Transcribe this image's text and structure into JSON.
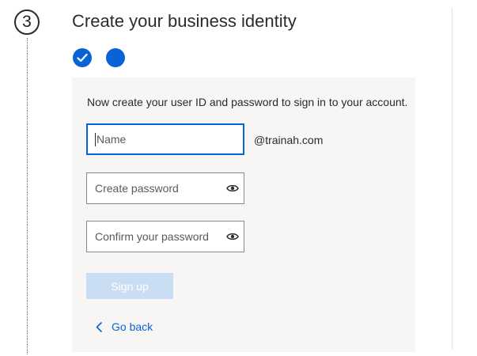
{
  "step": {
    "number": "3"
  },
  "header": {
    "title": "Create your business identity"
  },
  "progress": {
    "steps": [
      {
        "state": "completed",
        "icon": "check-icon"
      },
      {
        "state": "current"
      }
    ],
    "accent_color": "#0a63d6"
  },
  "form": {
    "instruction": "Now create your user ID and password to sign in to your account.",
    "name_field": {
      "placeholder": "Name",
      "value": ""
    },
    "domain_suffix": "@trainah.com",
    "password_field": {
      "placeholder": "Create password",
      "value": "",
      "icon": "eye-icon"
    },
    "confirm_field": {
      "placeholder": "Confirm your password",
      "value": "",
      "icon": "eye-icon"
    },
    "signup_label": "Sign up",
    "signup_state": "disabled",
    "back_label": "Go back",
    "back_icon": "chevron-left-icon"
  }
}
